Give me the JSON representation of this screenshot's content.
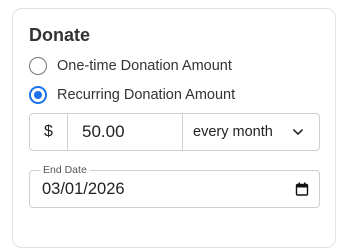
{
  "donate": {
    "title": "Donate",
    "options": [
      {
        "label": "One-time Donation Amount",
        "selected": false
      },
      {
        "label": "Recurring Donation Amount",
        "selected": true
      }
    ],
    "amount": {
      "currency_symbol": "$",
      "value": "50.00",
      "frequency": "every month"
    },
    "end_date": {
      "label": "End Date",
      "value": "03/01/2026"
    }
  },
  "colors": {
    "accent": "#1a73e8",
    "text": "#333333",
    "border": "#cfcfcf"
  },
  "icons": {
    "radio_selected": "radio-selected-icon",
    "dropdown": "chevron-down-icon",
    "calendar": "calendar-icon"
  }
}
